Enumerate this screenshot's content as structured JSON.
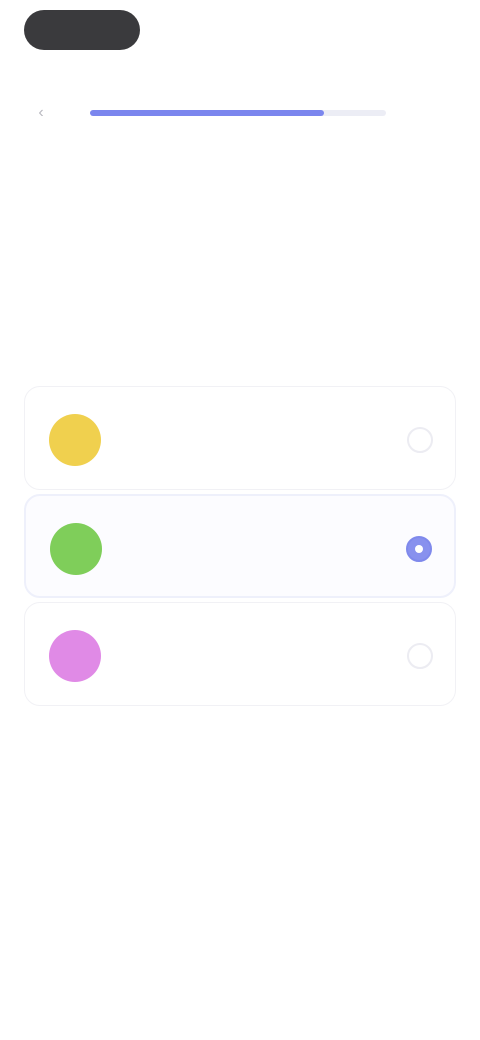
{
  "top_bar": {
    "pill_label": "",
    "skip_label": ""
  },
  "progress": {
    "fraction": 0.79,
    "step_text": ""
  },
  "eyebrow": "",
  "question": "",
  "subtitle": "",
  "options": [
    {
      "label": "",
      "color": "#f0d04e",
      "icon": "sun-icon",
      "selected": false
    },
    {
      "label": "",
      "color": "#7fce5a",
      "icon": "leaf-icon",
      "selected": true
    },
    {
      "label": "",
      "color": "#e08ae6",
      "icon": "flower-icon",
      "selected": false
    }
  ],
  "colors": {
    "accent": "#7b86ee",
    "track": "#ecedf5"
  }
}
